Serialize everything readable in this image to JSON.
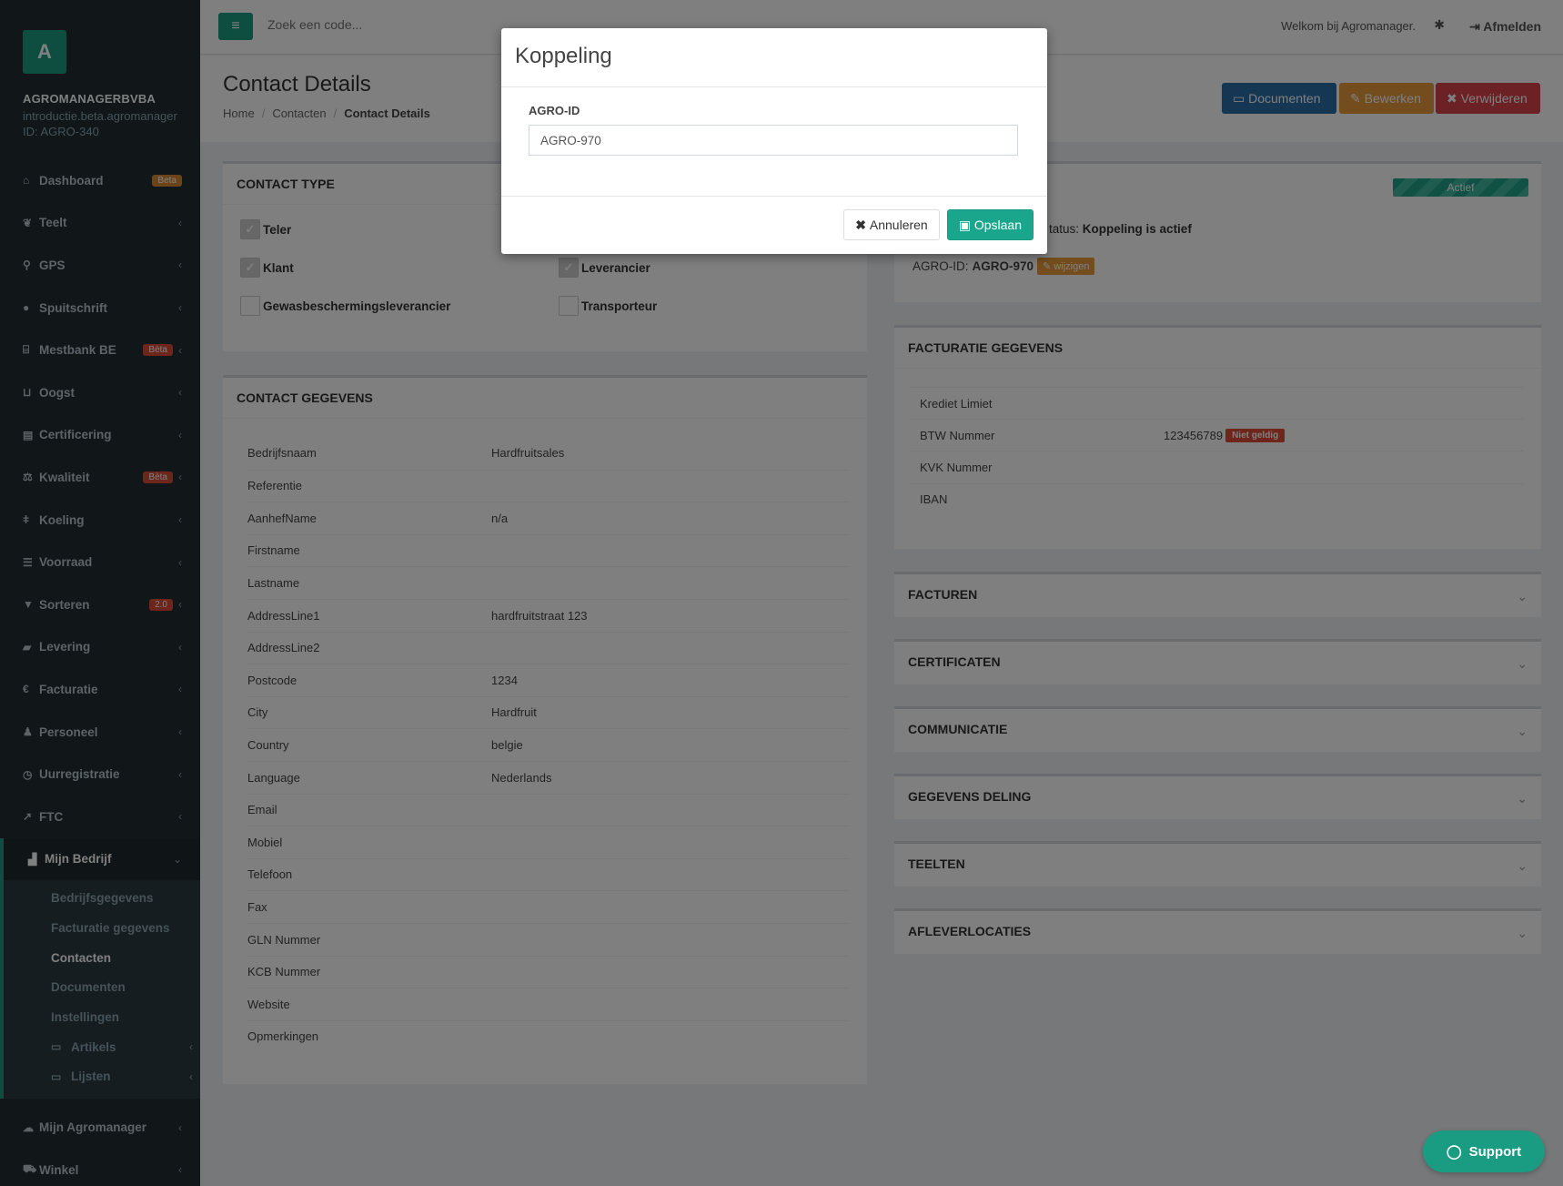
{
  "sidebar": {
    "logo_letter": "A",
    "company": "AGROMANAGERBVBA",
    "subdomain": "introductie.beta.agromanager",
    "id": "ID: AGRO-340",
    "items": [
      {
        "label": "Dashboard",
        "icon": "home-icon",
        "badge": "Beta"
      },
      {
        "label": "Teelt",
        "icon": "leaf-icon"
      },
      {
        "label": "GPS",
        "icon": "map-marker-icon"
      },
      {
        "label": "Spuitschrift",
        "icon": "tint-icon"
      },
      {
        "label": "Mestbank BE",
        "icon": "bank-icon",
        "badge": "Bèta"
      },
      {
        "label": "Oogst",
        "icon": "basket-icon"
      },
      {
        "label": "Certificering",
        "icon": "book-icon"
      },
      {
        "label": "Kwaliteit",
        "icon": "balance-icon",
        "badge": "Bèta"
      },
      {
        "label": "Koeling",
        "icon": "thermometer-icon"
      },
      {
        "label": "Voorraad",
        "icon": "list-icon"
      },
      {
        "label": "Sorteren",
        "icon": "filter-icon",
        "badge": "2.0"
      },
      {
        "label": "Levering",
        "icon": "truck-icon"
      },
      {
        "label": "Facturatie",
        "icon": "euro-icon"
      },
      {
        "label": "Personeel",
        "icon": "user-icon"
      },
      {
        "label": "Uurregistratie",
        "icon": "clock-icon"
      },
      {
        "label": "FTC",
        "icon": "chart-icon"
      }
    ],
    "active": {
      "label": "Mijn Bedrijf",
      "icon": "industry-icon"
    },
    "subitems": [
      {
        "label": "Bedrijfsgegevens"
      },
      {
        "label": "Facturatie gegevens"
      },
      {
        "label": "Contacten"
      },
      {
        "label": "Documenten"
      },
      {
        "label": "Instellingen"
      },
      {
        "label": "Artikels"
      },
      {
        "label": "Lijsten"
      }
    ],
    "bottom": [
      {
        "label": "Mijn Agromanager",
        "icon": "cloud-icon"
      },
      {
        "label": "Winkel",
        "icon": "cart-icon"
      }
    ]
  },
  "topbar": {
    "search_placeholder": "Zoek een code...",
    "welcome": "Welkom bij Agromanager.",
    "logout": "Afmelden"
  },
  "page": {
    "title": "Contact Details",
    "breadcrumb": [
      "Home",
      "Contacten",
      "Contact Details"
    ],
    "buttons": {
      "documents": "Documenten",
      "edit": "Bewerken",
      "delete": "Verwijderen"
    }
  },
  "contact_type": {
    "title": "CONTACT TYPE",
    "options": [
      {
        "label": "Teler",
        "checked": true
      },
      {
        "label": "Klant",
        "checked": true
      },
      {
        "label": "Leverancier",
        "checked": true
      },
      {
        "label": "Gewasbeschermingsleverancier",
        "checked": false
      },
      {
        "label": "Transporteur",
        "checked": false
      }
    ]
  },
  "contact_gegevens": {
    "title": "CONTACT GEGEVENS",
    "rows": [
      {
        "k": "Bedrijfsnaam",
        "v": "Hardfruitsales"
      },
      {
        "k": "Referentie",
        "v": ""
      },
      {
        "k": "AanhefName",
        "v": "n/a"
      },
      {
        "k": "Firstname",
        "v": ""
      },
      {
        "k": "Lastname",
        "v": ""
      },
      {
        "k": "AddressLine1",
        "v": "hardfruitstraat 123"
      },
      {
        "k": "AddressLine2",
        "v": ""
      },
      {
        "k": "Postcode",
        "v": "1234"
      },
      {
        "k": "City",
        "v": "Hardfruit"
      },
      {
        "k": "Country",
        "v": "belgie"
      },
      {
        "k": "Language",
        "v": "Nederlands"
      },
      {
        "k": "Email",
        "v": ""
      },
      {
        "k": "Mobiel",
        "v": ""
      },
      {
        "k": "Telefoon",
        "v": ""
      },
      {
        "k": "Fax",
        "v": ""
      },
      {
        "k": "GLN Nummer",
        "v": ""
      },
      {
        "k": "KCB Nummer",
        "v": ""
      },
      {
        "k": "Website",
        "v": ""
      },
      {
        "k": "Opmerkingen",
        "v": ""
      }
    ]
  },
  "koppeling": {
    "status_badge": "Actief",
    "status_prefix": "tatus:",
    "status_value": "Koppeling is actief",
    "agro_label": "AGRO-ID:",
    "agro_value": "AGRO-970",
    "change": "wijzigen"
  },
  "facturatie": {
    "title": "FACTURATIE GEGEVENS",
    "rows": [
      {
        "k": "Krediet Limiet",
        "v": ""
      },
      {
        "k": "BTW Nummer",
        "v": "123456789",
        "badge": "Niet geldig"
      },
      {
        "k": "KVK Nummer",
        "v": ""
      },
      {
        "k": "IBAN",
        "v": ""
      }
    ]
  },
  "collapsed_boxes": [
    "FACTUREN",
    "CERTIFICATEN",
    "COMMUNICATIE",
    "GEGEVENS DELING",
    "TEELTEN",
    "AFLEVERLOCATIES"
  ],
  "modal": {
    "title": "Koppeling",
    "field_label": "AGRO-ID",
    "field_value": "AGRO-970",
    "cancel": "Annuleren",
    "save": "Opslaan"
  },
  "support": {
    "label": "Support"
  }
}
